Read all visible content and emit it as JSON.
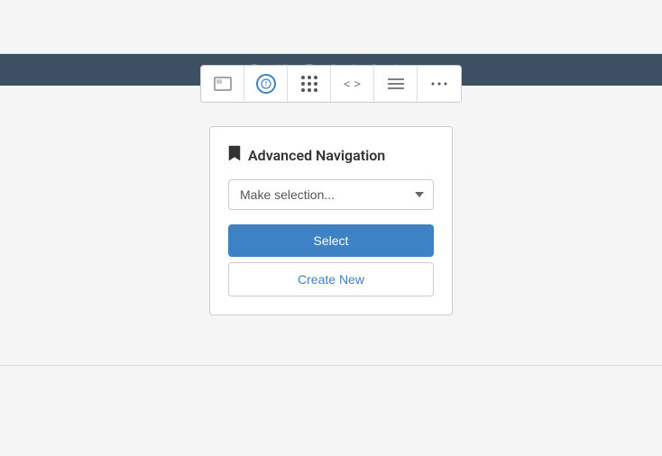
{
  "header": {
    "band_text": "Providing Top Quality Service",
    "title": "Advanced Navigation"
  },
  "toolbar": {
    "items": [
      {
        "id": "flag",
        "icon": "flag",
        "label": "flag-icon"
      },
      {
        "id": "compass",
        "icon": "compass",
        "label": "compass-icon"
      },
      {
        "id": "dots",
        "icon": "grid-dots",
        "label": "grid-dots-icon"
      },
      {
        "id": "code",
        "icon": "code-arrows",
        "label": "code-icon"
      },
      {
        "id": "lines",
        "icon": "lines",
        "label": "lines-icon"
      },
      {
        "id": "more",
        "icon": "ellipsis",
        "label": "more-icon"
      }
    ]
  },
  "widget": {
    "title": "Advanced Navigation",
    "title_icon": "bookmark",
    "select": {
      "placeholder": "Make selection...",
      "options": [
        "Make selection..."
      ]
    },
    "buttons": {
      "select_label": "Select",
      "create_new_label": "Create New"
    }
  },
  "colors": {
    "accent": "#3d82c4",
    "header_bg": "#3d4f63",
    "card_border": "#cccccc"
  }
}
